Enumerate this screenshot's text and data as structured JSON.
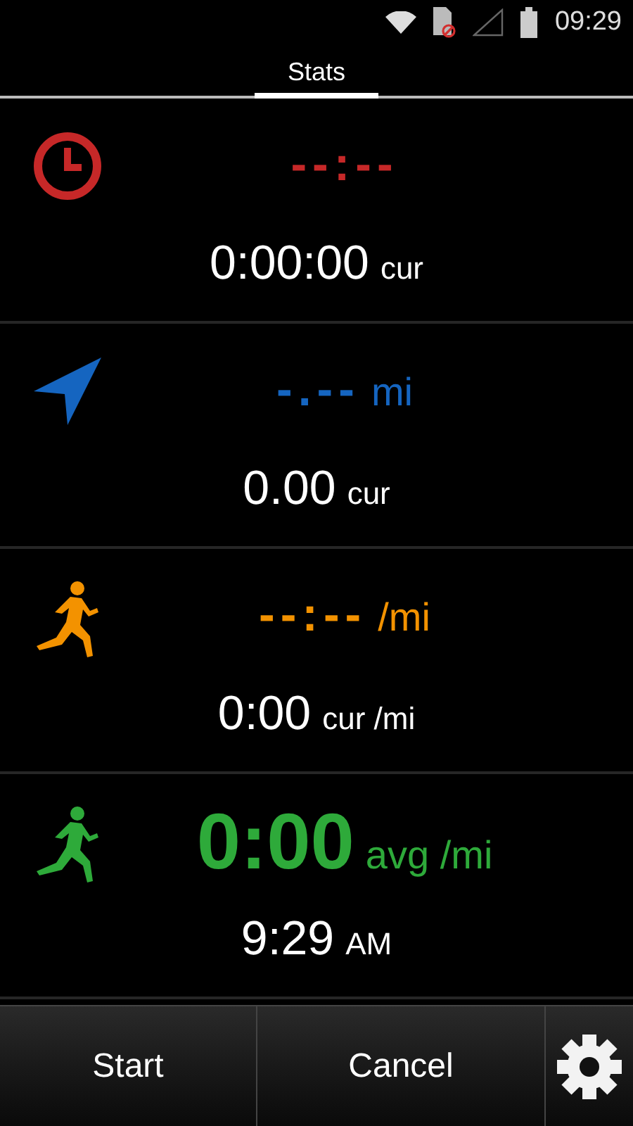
{
  "status_bar": {
    "time": "09:29"
  },
  "tabs": [
    {
      "label": "Stats",
      "selected": true
    }
  ],
  "panels": [
    {
      "kind": "clock",
      "color": "#c62828",
      "value": "--:--",
      "sub_value": "0:00:00",
      "sub_unit": "cur",
      "large": false
    },
    {
      "kind": "distance",
      "color": "#1565c0",
      "value": "-.--",
      "unit": "mi",
      "sub_value": "0.00",
      "sub_unit": "cur",
      "large": false
    },
    {
      "kind": "pace",
      "color": "#f39200",
      "value": "--:--",
      "unit": "/mi",
      "sub_value": "0:00",
      "sub_unit": "cur /mi",
      "large": false
    },
    {
      "kind": "avg-pace",
      "color": "#2eaa3a",
      "value": "0:00",
      "unit": "avg /mi",
      "sub_value": "9:29",
      "sub_unit": "AM",
      "large": true
    }
  ],
  "buttons": [
    {
      "label": "Start"
    },
    {
      "label": "Cancel"
    }
  ]
}
